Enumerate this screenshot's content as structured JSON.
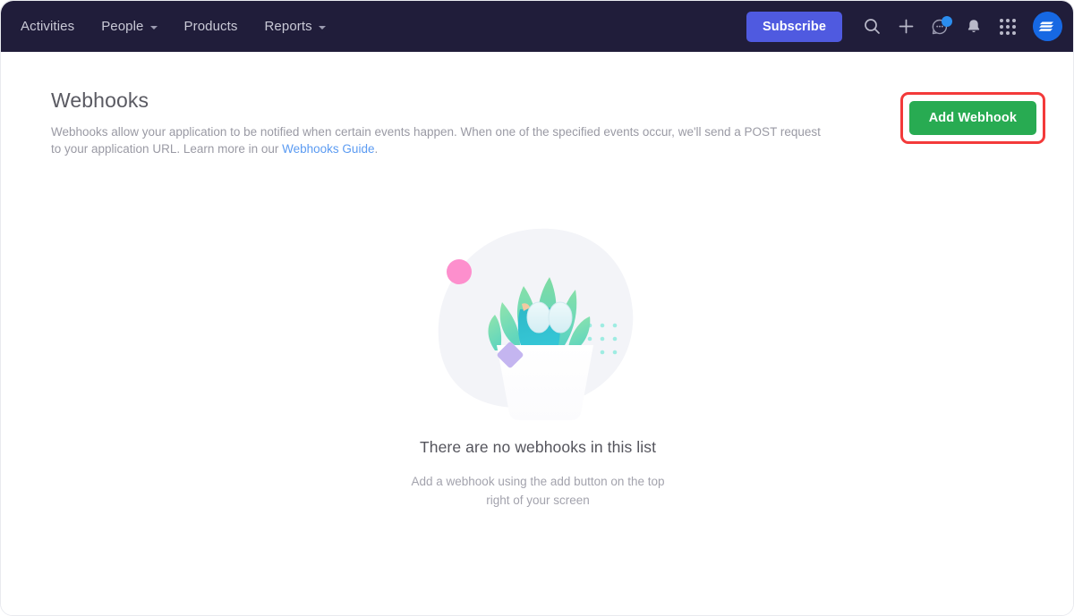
{
  "nav": {
    "items": [
      {
        "label": "Activities",
        "has_caret": false
      },
      {
        "label": "People",
        "has_caret": true
      },
      {
        "label": "Products",
        "has_caret": false
      },
      {
        "label": "Reports",
        "has_caret": true
      }
    ],
    "subscribe_label": "Subscribe",
    "icons": [
      {
        "name": "search-icon"
      },
      {
        "name": "plus-icon"
      },
      {
        "name": "chat-icon",
        "badge": true
      },
      {
        "name": "bell-icon"
      },
      {
        "name": "apps-grid-icon"
      }
    ],
    "avatar_name": "user-avatar"
  },
  "page": {
    "title": "Webhooks",
    "description_part1": "Webhooks allow your application to be notified when certain events happen. When one of the specified events occur, we'll send a POST request to your application URL. Learn more in our ",
    "link_label": "Webhooks Guide",
    "description_part2": ".",
    "add_button_label": "Add Webhook"
  },
  "empty_state": {
    "illustration_name": "empty-plant-illustration",
    "title": "There are no webhooks in this list",
    "subtitle_line1": "Add a webhook using the add button on the top",
    "subtitle_line2": "right of your screen"
  },
  "colors": {
    "navbar_bg": "#201d3a",
    "subscribe_bg": "#4f5ae0",
    "add_button_bg": "#28ab52",
    "highlight_border": "#f33a3a",
    "link": "#5b9bf2",
    "badge": "#2b8dee"
  }
}
